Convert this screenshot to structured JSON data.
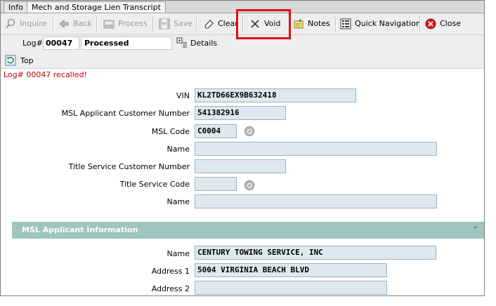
{
  "tabs": [
    {
      "label": "Info"
    },
    {
      "label": "Mech and Storage Lien Transcript"
    }
  ],
  "toolbar": {
    "inquire": "Inquire",
    "back": "Back",
    "process": "Process",
    "save": "Save",
    "clear": "Clear",
    "void": "Void",
    "notes": "Notes",
    "quick_nav": "Quick Navigation",
    "close": "Close"
  },
  "log": {
    "label": "Log#",
    "number": "00047",
    "status": "Processed",
    "details": "Details"
  },
  "top_label": "Top",
  "message": "Log# 00047 recalled!",
  "form": {
    "vin_label": "VIN",
    "vin": "KL2TD66EX9B632418",
    "cust_num_label": "MSL Applicant Customer Number",
    "cust_num": "541382916",
    "msl_code_label": "MSL Code",
    "msl_code": "C0004",
    "name_label_1": "Name",
    "name_1": "",
    "title_cust_label": "Title Service Customer Number",
    "title_cust": "",
    "title_code_label": "Title Service Code",
    "title_code": "",
    "name_label_2": "Name",
    "name_2": ""
  },
  "section": {
    "title": "MSL Applicant Information",
    "name_label": "Name",
    "name": "CENTURY TOWING SERVICE, INC",
    "addr1_label": "Address 1",
    "addr1": "5004 VIRGINIA BEACH BLVD",
    "addr2_label": "Address 2",
    "addr2": ""
  },
  "colors": {
    "highlight": "#e0101a",
    "field_bg": "#dde9ee",
    "section_bg": "#9ec5c0",
    "message": "#cc0000"
  }
}
